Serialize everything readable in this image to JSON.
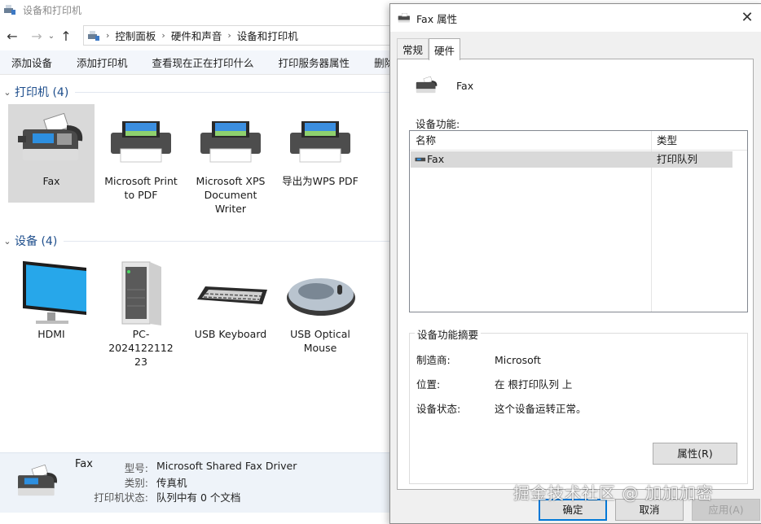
{
  "explorer": {
    "title": "设备和打印机",
    "breadcrumbs": [
      "控制面板",
      "硬件和声音",
      "设备和打印机"
    ],
    "toolbar": [
      "添加设备",
      "添加打印机",
      "查看现在正在打印什么",
      "打印服务器属性",
      "删除设"
    ],
    "printers_header": "打印机 (4)",
    "printers": [
      {
        "label": "Fax",
        "icon": "fax-icon",
        "selected": true
      },
      {
        "label": "Microsoft Print to PDF",
        "icon": "printer-icon"
      },
      {
        "label": "Microsoft XPS Document Writer",
        "icon": "printer-icon"
      },
      {
        "label": "导出为WPS PDF",
        "icon": "printer-icon"
      }
    ],
    "devices_header": "设备 (4)",
    "devices": [
      {
        "label": "HDMI",
        "icon": "monitor-icon"
      },
      {
        "label": "PC-2024122112 23",
        "icon": "computer-tower-icon"
      },
      {
        "label": "USB Keyboard",
        "icon": "keyboard-icon"
      },
      {
        "label": "USB Optical Mouse",
        "icon": "mouse-icon"
      }
    ],
    "status": {
      "name": "Fax",
      "rows": [
        {
          "key": "型号:",
          "value": "Microsoft Shared Fax Driver"
        },
        {
          "key": "类别:",
          "value": "传真机"
        },
        {
          "key": "打印机状态:",
          "value": "队列中有 0 个文档"
        }
      ]
    }
  },
  "dialog": {
    "title": "Fax 属性",
    "tabs": [
      "常规",
      "硬件"
    ],
    "active_tab": "硬件",
    "device_name": "Fax",
    "functions_label": "设备功能:",
    "columns": [
      "名称",
      "类型"
    ],
    "rows": [
      {
        "name": "Fax",
        "type": "打印队列"
      }
    ],
    "summary_label": "设备功能摘要",
    "summary": [
      {
        "key": "制造商:",
        "value": "Microsoft"
      },
      {
        "key": "位置:",
        "value": "在 根打印队列 上"
      },
      {
        "key": "设备状态:",
        "value": "这个设备运转正常。"
      }
    ],
    "properties_button": "属性(R)",
    "ok_button": "确定",
    "cancel_button": "取消",
    "apply_button": "应用(A)"
  },
  "watermark": "掘金技术社区 @ 加加加密",
  "colors": {
    "group_title": "#1e4e8c",
    "selection": "#d9d9d9",
    "focus_border": "#0078d7"
  }
}
